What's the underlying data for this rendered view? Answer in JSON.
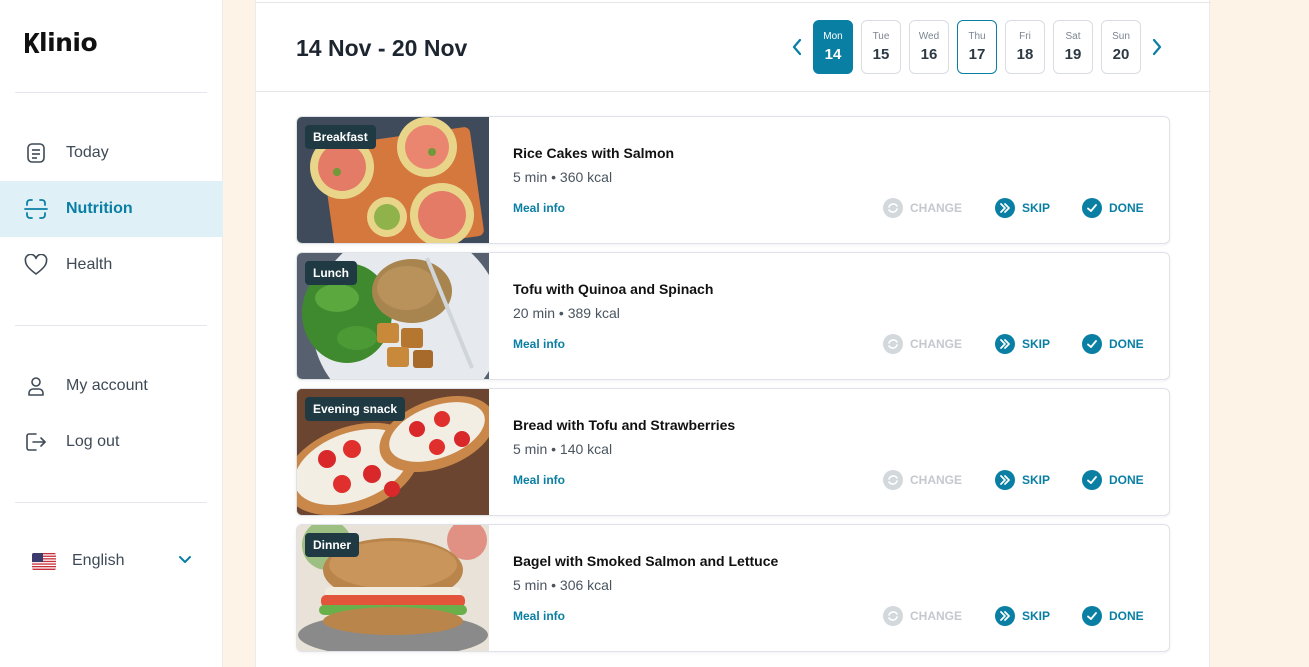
{
  "app": {
    "logo_text": "linio"
  },
  "sidebar": {
    "items": [
      {
        "label": "Today",
        "icon": "document-icon",
        "active": false
      },
      {
        "label": "Nutrition",
        "icon": "scan-food-icon",
        "active": true
      },
      {
        "label": "Health",
        "icon": "heart-icon",
        "active": false
      }
    ],
    "account_items": [
      {
        "label": "My account",
        "icon": "user-icon"
      },
      {
        "label": "Log out",
        "icon": "logout-icon"
      }
    ],
    "language": {
      "label": "English",
      "flag": "us-flag-icon"
    }
  },
  "week": {
    "range": "14 Nov - 20 Nov",
    "days": [
      {
        "name": "Mon",
        "date": "14"
      },
      {
        "name": "Tue",
        "date": "15"
      },
      {
        "name": "Wed",
        "date": "16"
      },
      {
        "name": "Thu",
        "date": "17"
      },
      {
        "name": "Fri",
        "date": "18"
      },
      {
        "name": "Sat",
        "date": "19"
      },
      {
        "name": "Sun",
        "date": "20"
      }
    ]
  },
  "meals": [
    {
      "type": "Breakfast",
      "title": "Rice Cakes with Salmon",
      "meta": "5 min • 360 kcal",
      "info": "Meal info",
      "change": "CHANGE",
      "skip": "SKIP",
      "done": "DONE"
    },
    {
      "type": "Lunch",
      "title": "Tofu with Quinoa and Spinach",
      "meta": "20 min • 389 kcal",
      "info": "Meal info",
      "change": "CHANGE",
      "skip": "SKIP",
      "done": "DONE"
    },
    {
      "type": "Evening snack",
      "title": "Bread with Tofu and Strawberries",
      "meta": "5 min • 140 kcal",
      "info": "Meal info",
      "change": "CHANGE",
      "skip": "SKIP",
      "done": "DONE"
    },
    {
      "type": "Dinner",
      "title": "Bagel with Smoked Salmon and Lettuce",
      "meta": "5 min • 306 kcal",
      "info": "Meal info",
      "change": "CHANGE",
      "skip": "SKIP",
      "done": "DONE"
    }
  ],
  "colors": {
    "accent": "#0a7fa4",
    "active_bg": "#dff0f6",
    "page_bg": "#fdf3e6",
    "badge_bg": "#1f3a42"
  }
}
